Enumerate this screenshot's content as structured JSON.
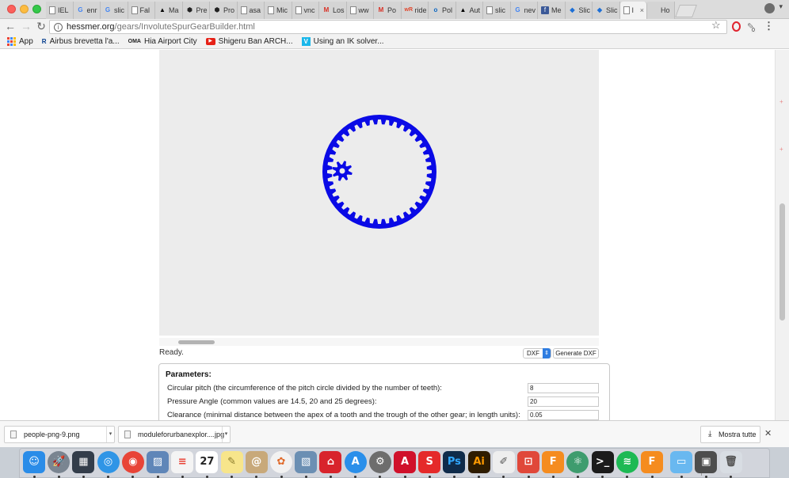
{
  "browser": {
    "tabs": [
      {
        "label": "IEL",
        "icon": "doc"
      },
      {
        "label": "enr",
        "icon": "g"
      },
      {
        "label": "slic",
        "icon": "g"
      },
      {
        "label": "Fal",
        "icon": "doc"
      },
      {
        "label": "Ma",
        "icon": "b"
      },
      {
        "label": "Pre",
        "icon": "hexa"
      },
      {
        "label": "Pro",
        "icon": "hexa"
      },
      {
        "label": "asa",
        "icon": "doc"
      },
      {
        "label": "Mic",
        "icon": "doc"
      },
      {
        "label": "vnc",
        "icon": "doc"
      },
      {
        "label": "Los",
        "icon": "m"
      },
      {
        "label": "ww",
        "icon": "doc"
      },
      {
        "label": "Po",
        "icon": "m"
      },
      {
        "label": "ride",
        "icon": "w"
      },
      {
        "label": "Pol",
        "icon": "o"
      },
      {
        "label": "Aut",
        "icon": "b"
      },
      {
        "label": "slic",
        "icon": "doc"
      },
      {
        "label": "nev",
        "icon": "g"
      },
      {
        "label": "Me",
        "icon": "f"
      },
      {
        "label": "Slic",
        "icon": "clap"
      },
      {
        "label": "Slic",
        "icon": "clap"
      },
      {
        "label": "I",
        "icon": "doc",
        "active": true,
        "close": "×"
      },
      {
        "label": "Ho",
        "icon": "apple"
      }
    ],
    "url_host": "hessmer.org",
    "url_path": "/gears/InvoluteSpurGearBuilder.html",
    "info_glyph": "i",
    "star_glyph": "☆",
    "menu_glyph": "⋮",
    "ext_badge": "0",
    "tabs_menu_glyph": "▾"
  },
  "bookmarks": [
    {
      "label": "App",
      "icon": "apps"
    },
    {
      "label": "Airbus brevetta l'a...",
      "icon": "rb",
      "glyph": "R"
    },
    {
      "label": "Hia Airport City",
      "icon": "oma",
      "glyph": "OMA"
    },
    {
      "label": "Shigeru Ban ARCH...",
      "icon": "yt",
      "glyph": "▶"
    },
    {
      "label": "Using an IK solver...",
      "icon": "v",
      "glyph": "V"
    }
  ],
  "page": {
    "status": "Ready.",
    "format_selected": "DXF",
    "generate_button": "Generate DXF",
    "params_title": "Parameters:",
    "params": [
      {
        "label": "Circular pitch (the circumference of the pitch circle divided by the number of teeth):",
        "value": "8"
      },
      {
        "label": "Pressure Angle (common values are 14.5, 20 and 25 degrees):",
        "value": "20"
      },
      {
        "label": "Clearance (minimal distance between the apex of a tooth and the trough of the other gear; in length units):",
        "value": "0.05"
      }
    ],
    "gear_color": "#0a0ae6",
    "ring_teeth": 40,
    "pinion_teeth": 8
  },
  "downloads": [
    {
      "name": "people-png-9.png"
    },
    {
      "name": "moduleforurbanexplor....jpg"
    }
  ],
  "show_all": "Mostra tutte",
  "dock": [
    {
      "name": "finder",
      "color": "#2a8ce8",
      "glyph": "☺"
    },
    {
      "name": "launchpad",
      "color": "#7a8591",
      "glyph": "🚀"
    },
    {
      "name": "dashboard",
      "color": "#333d4a",
      "glyph": "▦"
    },
    {
      "name": "safari",
      "color": "#2f95e6",
      "glyph": "◎"
    },
    {
      "name": "chrome",
      "color": "#e84437",
      "glyph": "◉"
    },
    {
      "name": "preview",
      "color": "#5f86b8",
      "glyph": "▨"
    },
    {
      "name": "reminders",
      "color": "#f4f4f4",
      "glyph": "≡",
      "fg": "#e94235"
    },
    {
      "name": "calendar",
      "color": "#ffffff",
      "glyph": "27",
      "fg": "#222"
    },
    {
      "name": "notes",
      "color": "#f7e58b",
      "glyph": "✎",
      "fg": "#8a7a2a"
    },
    {
      "name": "contacts",
      "color": "#c8a97a",
      "glyph": "@"
    },
    {
      "name": "photos",
      "color": "#f2f2f2",
      "glyph": "✿",
      "fg": "#e06a2a"
    },
    {
      "name": "preview2",
      "color": "#6b8fb3",
      "glyph": "▧"
    },
    {
      "name": "autodesk",
      "color": "#d8242c",
      "glyph": "⌂"
    },
    {
      "name": "app-store",
      "color": "#2a8fea",
      "glyph": "A"
    },
    {
      "name": "system-prefs",
      "color": "#6d6d6d",
      "glyph": "⚙"
    },
    {
      "name": "autocad",
      "color": "#d0112b",
      "glyph": "A"
    },
    {
      "name": "sketchup",
      "color": "#e52a2a",
      "glyph": "S"
    },
    {
      "name": "photoshop",
      "color": "#0f2b4a",
      "glyph": "Ps",
      "fg": "#31a8ff"
    },
    {
      "name": "illustrator",
      "color": "#2e1c00",
      "glyph": "Ai",
      "fg": "#ff9a00"
    },
    {
      "name": "textedit",
      "color": "#eeeeee",
      "glyph": "✐",
      "fg": "#555"
    },
    {
      "name": "speakerdeck",
      "color": "#e0483a",
      "glyph": "⊡"
    },
    {
      "name": "fusion360",
      "color": "#f58c1f",
      "glyph": "F"
    },
    {
      "name": "atom",
      "color": "#3e9c6e",
      "glyph": "⚛"
    },
    {
      "name": "terminal",
      "color": "#1b1b1b",
      "glyph": ">_"
    },
    {
      "name": "spotify",
      "color": "#1db954",
      "glyph": "≋"
    },
    {
      "name": "fusion360-2",
      "color": "#f58c1f",
      "glyph": "F"
    },
    {
      "name": "downloads-folder",
      "color": "#69b8f0",
      "glyph": "▭"
    },
    {
      "name": "screenshot",
      "color": "#4d4d4d",
      "glyph": "▣"
    },
    {
      "name": "trash",
      "color": "#d8dde3",
      "glyph": "🗑",
      "fg": "#555"
    }
  ]
}
